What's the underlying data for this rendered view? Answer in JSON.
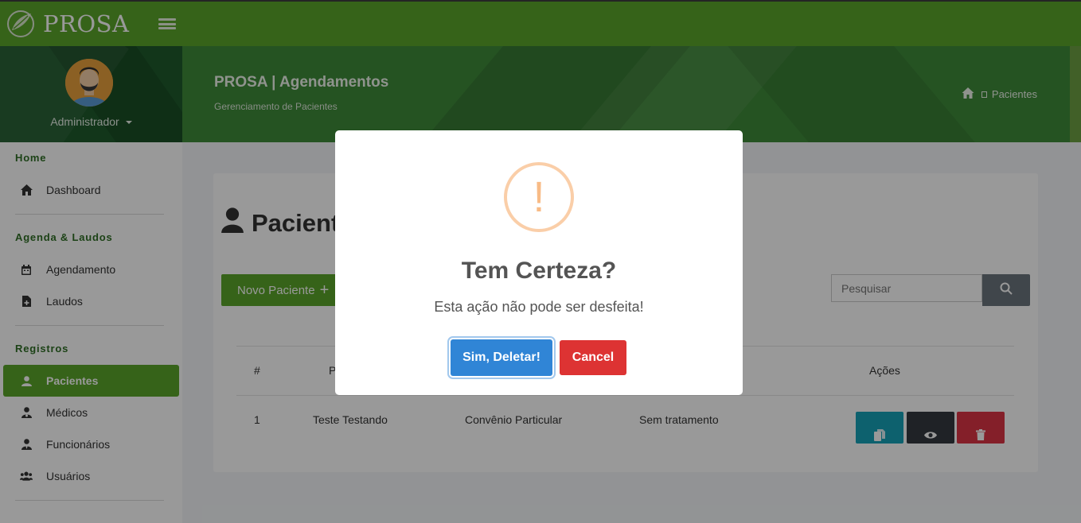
{
  "brand": {
    "name": "PROSA"
  },
  "sidebar": {
    "user_name": "Administrador",
    "sections": [
      {
        "label": "Home",
        "items": [
          {
            "label": "Dashboard",
            "icon": "home-icon"
          }
        ]
      },
      {
        "label": "Agenda & Laudos",
        "items": [
          {
            "label": "Agendamento",
            "icon": "calendar-icon"
          },
          {
            "label": "Laudos",
            "icon": "file-icon"
          }
        ]
      },
      {
        "label": "Registros",
        "items": [
          {
            "label": "Pacientes",
            "icon": "user-icon",
            "active": true
          },
          {
            "label": "Médicos",
            "icon": "doctor-icon"
          },
          {
            "label": "Funcionários",
            "icon": "employee-icon"
          },
          {
            "label": "Usuários",
            "icon": "users-icon"
          }
        ]
      }
    ]
  },
  "header": {
    "title": "PROSA | Agendamentos",
    "subtitle": "Gerenciamento de Pacientes",
    "breadcrumb": "Pacientes"
  },
  "main": {
    "title": "Pacientes",
    "new_button": "Novo Paciente",
    "search_placeholder": "Pesquisar",
    "table": {
      "headers": {
        "num": "#",
        "name": "P",
        "actions": "Ações"
      },
      "rows": [
        {
          "num": "1",
          "name": "Teste Testando",
          "insurance": "Convênio Particular",
          "treatment": "Sem tratamento"
        }
      ]
    }
  },
  "modal": {
    "icon_symbol": "!",
    "title": "Tem Certeza?",
    "text": "Esta ação não pode ser desfeita!",
    "confirm": "Sim, Deletar!",
    "cancel": "Cancel"
  },
  "colors": {
    "accent": "#5aa62a",
    "confirm": "#3085d6",
    "cancel": "#dd3333",
    "warning": "#f8bb86",
    "info": "#17a2b8",
    "dark": "#343a40",
    "danger": "#dc3545"
  }
}
